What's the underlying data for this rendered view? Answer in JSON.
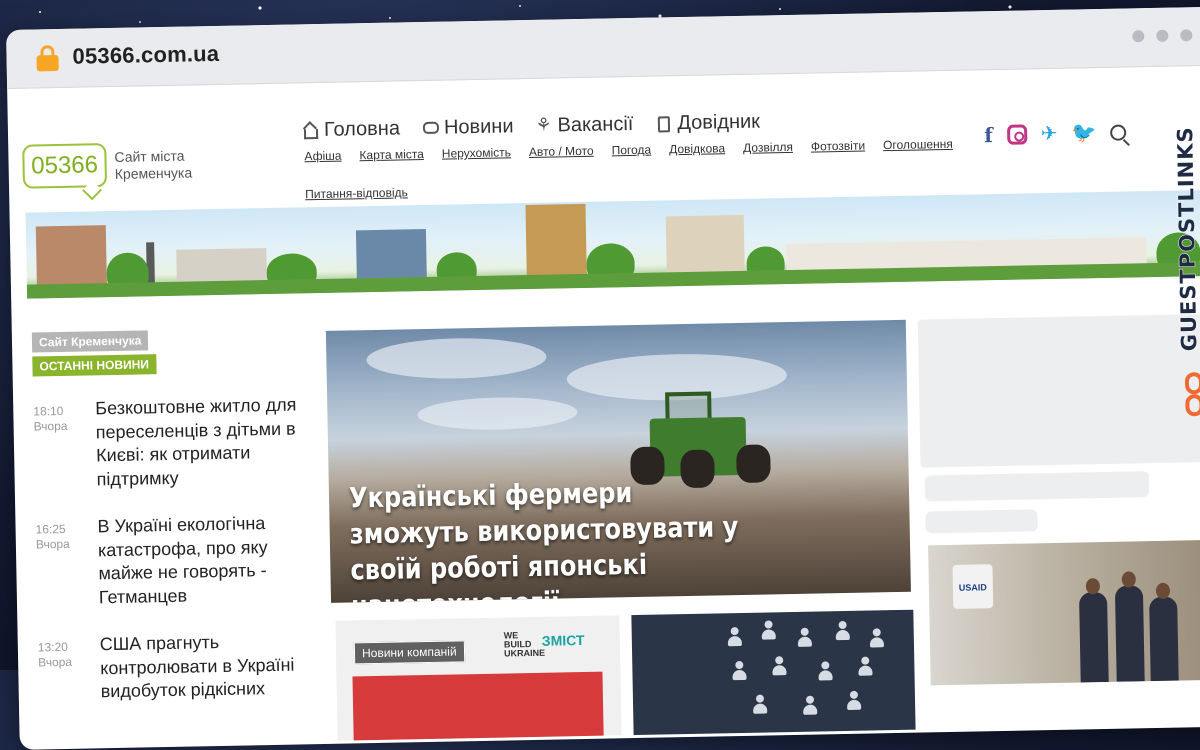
{
  "browser": {
    "url": "05366.com.ua"
  },
  "header": {
    "logo_number": "05366",
    "logo_text": "Сайт міста Кременчука",
    "main_nav": [
      {
        "label": "Головна",
        "icon": "home-icon"
      },
      {
        "label": "Новини",
        "icon": "chat-icon"
      },
      {
        "label": "Вакансії",
        "icon": "job-icon"
      },
      {
        "label": "Довідник",
        "icon": "book-icon"
      }
    ],
    "sub_nav": [
      "Афіша",
      "Карта міста",
      "Нерухомість",
      "Авто / Мото",
      "Погода",
      "Довідкова",
      "Дозвілля",
      "Фотозвіти",
      "Оголошення",
      "Питання-відповідь"
    ],
    "social": {
      "facebook": "f",
      "telegram": "✈",
      "twitter": "🐦"
    }
  },
  "sidebar": {
    "tag_site": "Сайт Кременчука",
    "tag_latest": "ОСТАННІ НОВИНИ",
    "news": [
      {
        "time": "18:10",
        "day": "Вчора",
        "title": "Безкоштовне житло для переселенців з дітьми в Києві: як отримати підтримку"
      },
      {
        "time": "16:25",
        "day": "Вчора",
        "title": "В Україні екологічна катастрофа, про яку майже не говорять - Гетманцев"
      },
      {
        "time": "13:20",
        "day": "Вчора",
        "title": "США прагнуть контролювати в Україні видобуток рідкісних"
      }
    ]
  },
  "main": {
    "featured_title": "Українські фермери зможуть використовувати у своїй роботі японські нанотехнології",
    "card1_badge": "Новини компаній",
    "card1_logo1": "WE BUILD UKRAINE",
    "card1_logo2": "ЗМІСТ"
  },
  "right": {
    "usaid_sign": "USAID"
  },
  "watermark": {
    "text": "GUESTPOSTLINKS"
  }
}
